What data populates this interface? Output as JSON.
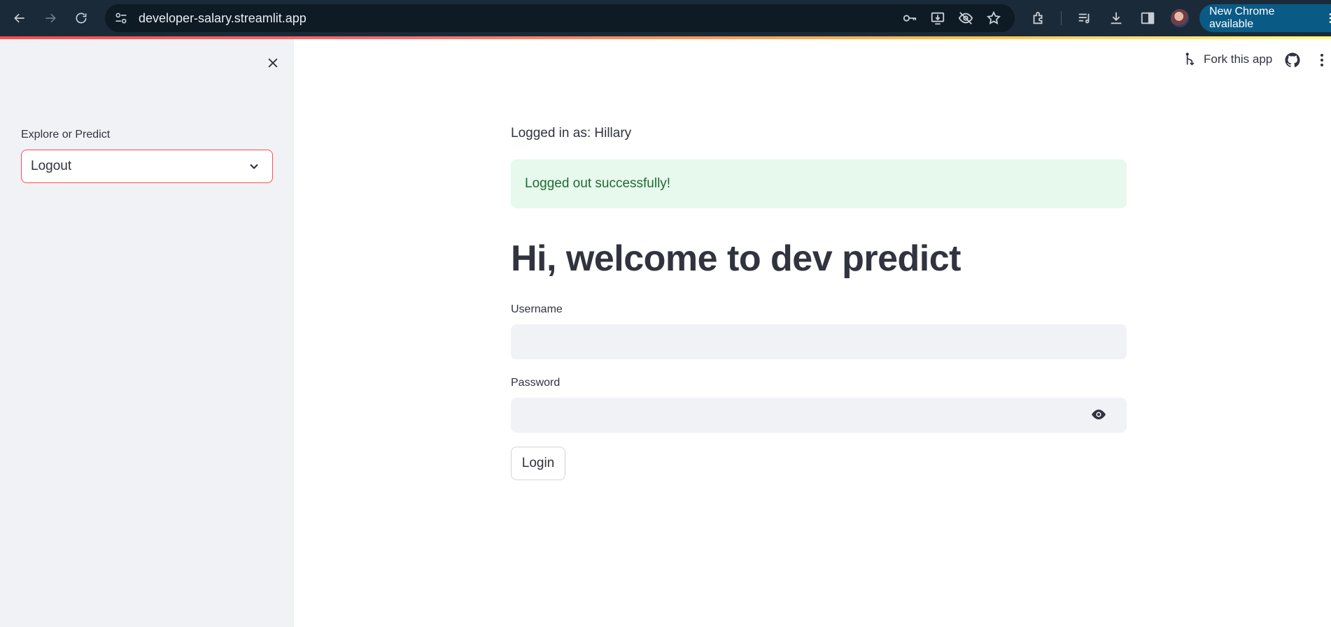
{
  "browser": {
    "url": "developer-salary.streamlit.app",
    "update_label": "New Chrome available",
    "update_more": "⋮"
  },
  "sidebar": {
    "select_label": "Explore or Predict",
    "select_value": "Logout"
  },
  "header": {
    "fork_label": "Fork this app"
  },
  "main": {
    "logged_in_text": "Logged in as: Hillary",
    "success_message": "Logged out successfully!",
    "title": "Hi, welcome to dev predict",
    "username_label": "Username",
    "username_value": "",
    "password_label": "Password",
    "password_value": "",
    "login_label": "Login"
  },
  "colors": {
    "accent": "#ff4b4b",
    "success_bg": "#e7f8ec",
    "success_text": "#1f6a33",
    "sidebar_bg": "#f0f2f6",
    "text": "#31333f"
  }
}
